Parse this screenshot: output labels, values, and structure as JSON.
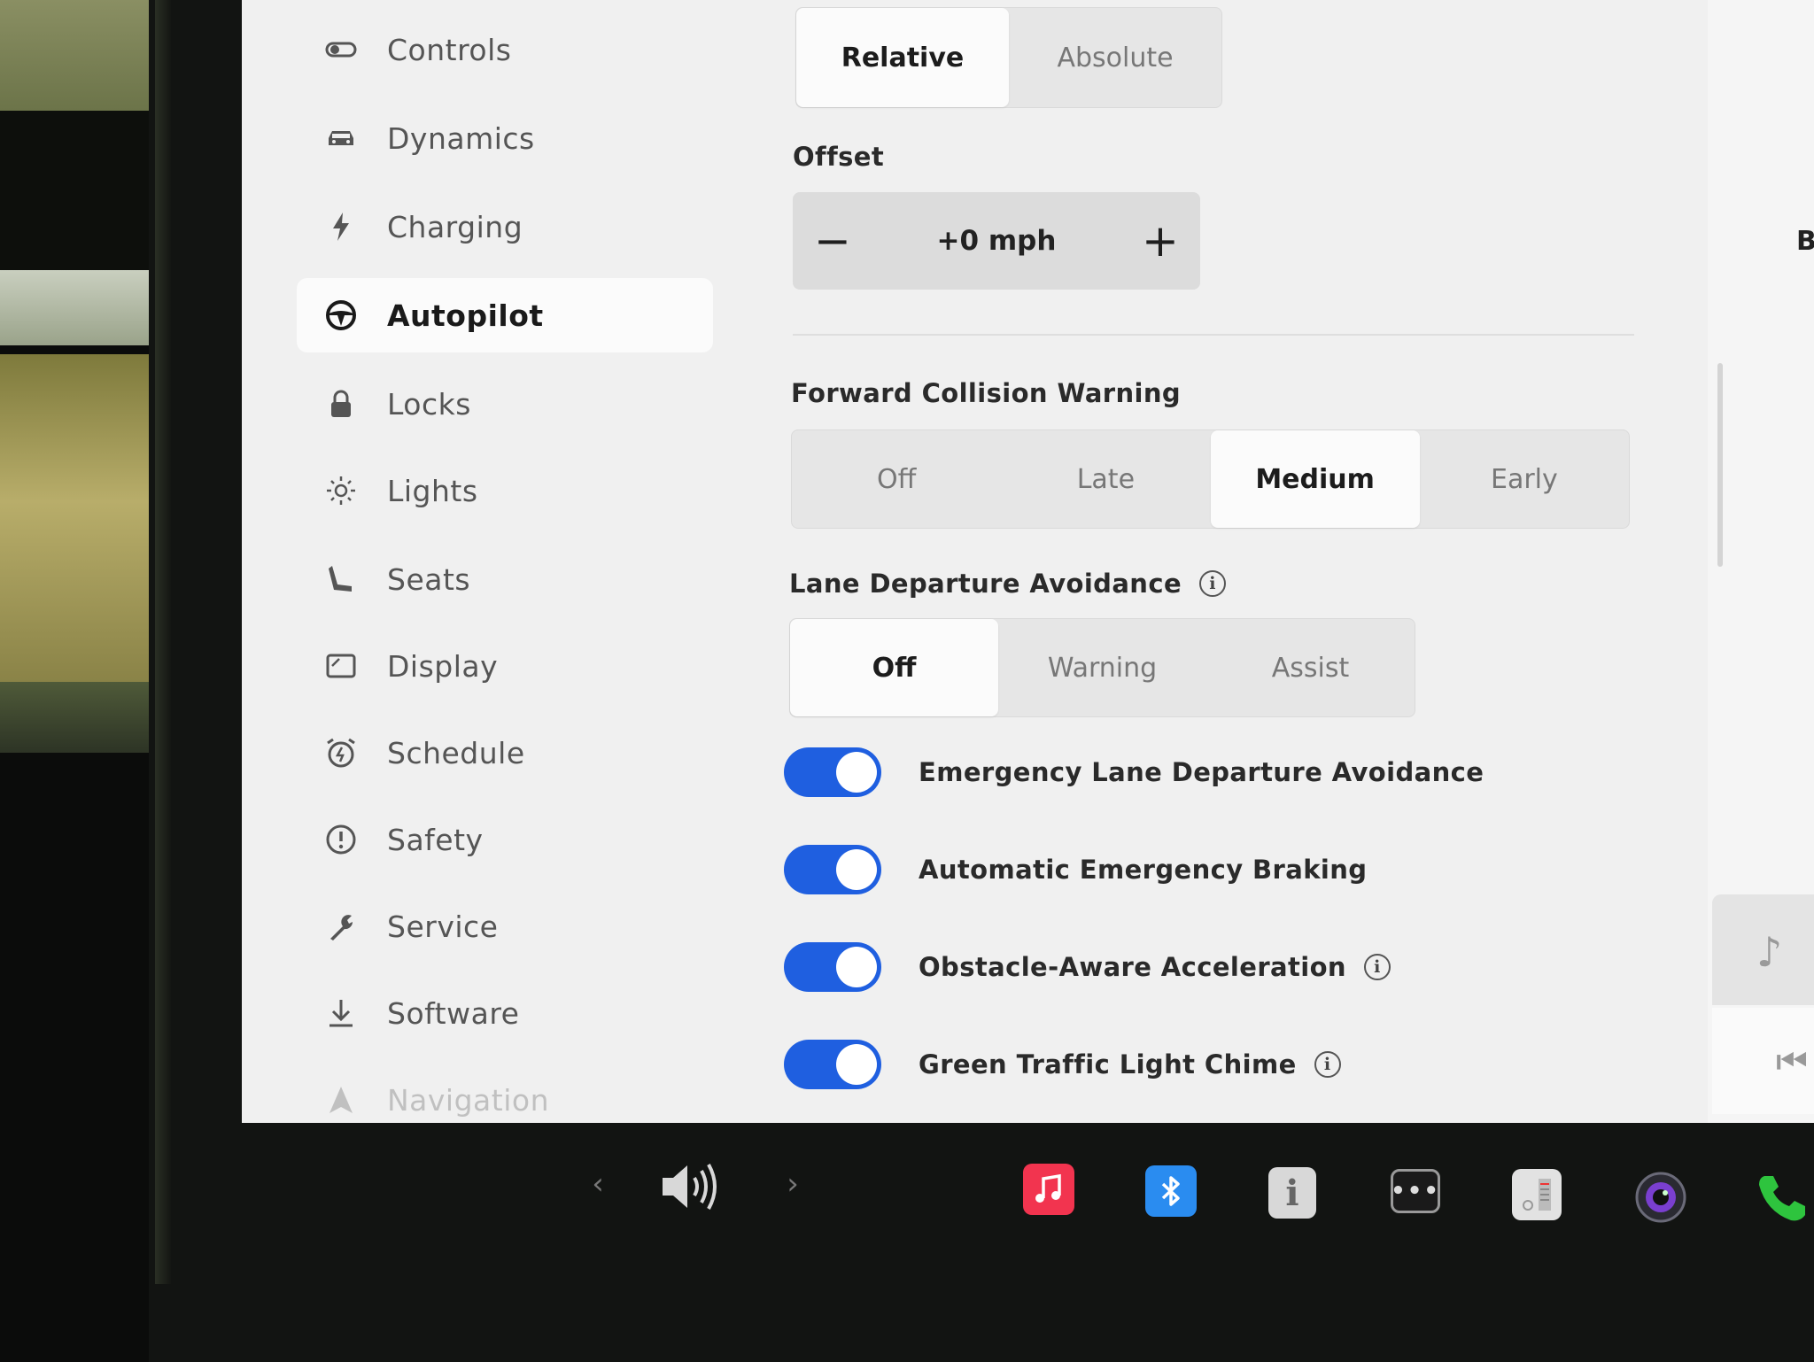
{
  "sidebar": {
    "items": [
      {
        "label": "Controls",
        "icon": "toggle-icon",
        "active": false
      },
      {
        "label": "Dynamics",
        "icon": "car-icon",
        "active": false
      },
      {
        "label": "Charging",
        "icon": "lightning-icon",
        "active": false
      },
      {
        "label": "Autopilot",
        "icon": "steering-wheel-icon",
        "active": true
      },
      {
        "label": "Locks",
        "icon": "lock-icon",
        "active": false
      },
      {
        "label": "Lights",
        "icon": "sun-icon",
        "active": false
      },
      {
        "label": "Seats",
        "icon": "seat-icon",
        "active": false
      },
      {
        "label": "Display",
        "icon": "display-icon",
        "active": false
      },
      {
        "label": "Schedule",
        "icon": "alarm-clock-icon",
        "active": false
      },
      {
        "label": "Safety",
        "icon": "alert-circle-icon",
        "active": false
      },
      {
        "label": "Service",
        "icon": "wrench-icon",
        "active": false
      },
      {
        "label": "Software",
        "icon": "download-icon",
        "active": false
      },
      {
        "label": "Navigation",
        "icon": "navigation-icon",
        "active": false
      }
    ]
  },
  "speed_limit_mode": {
    "options": [
      "Relative",
      "Absolute"
    ],
    "selected": "Relative"
  },
  "offset": {
    "label": "Offset",
    "value": "+0 mph",
    "minus": "−",
    "plus": "+"
  },
  "forward_collision": {
    "label": "Forward Collision Warning",
    "options": [
      "Off",
      "Late",
      "Medium",
      "Early"
    ],
    "selected": "Medium"
  },
  "lane_departure": {
    "label": "Lane Departure Avoidance",
    "info": "i",
    "options": [
      "Off",
      "Warning",
      "Assist"
    ],
    "selected": "Off"
  },
  "toggles": [
    {
      "label": "Emergency Lane Departure Avoidance",
      "on": true,
      "info": false
    },
    {
      "label": "Automatic Emergency Braking",
      "on": true,
      "info": false
    },
    {
      "label": "Obstacle-Aware Acceleration",
      "on": true,
      "info": true
    },
    {
      "label": "Green Traffic Light Chime",
      "on": true,
      "info": true
    }
  ],
  "right_pane": {
    "partial_text": "B"
  },
  "colors": {
    "toggle_on": "#1f5fe0",
    "apple_music": "#f2344f",
    "bluetooth": "#2a8cf0",
    "phone": "#2ec43e"
  },
  "taskbar": {
    "icons": [
      "chevron-left-icon",
      "volume-icon",
      "chevron-right-icon",
      "apple-music-icon",
      "bluetooth-icon",
      "manual-icon",
      "more-icon",
      "toybox-icon",
      "camera-icon",
      "phone-icon"
    ]
  }
}
